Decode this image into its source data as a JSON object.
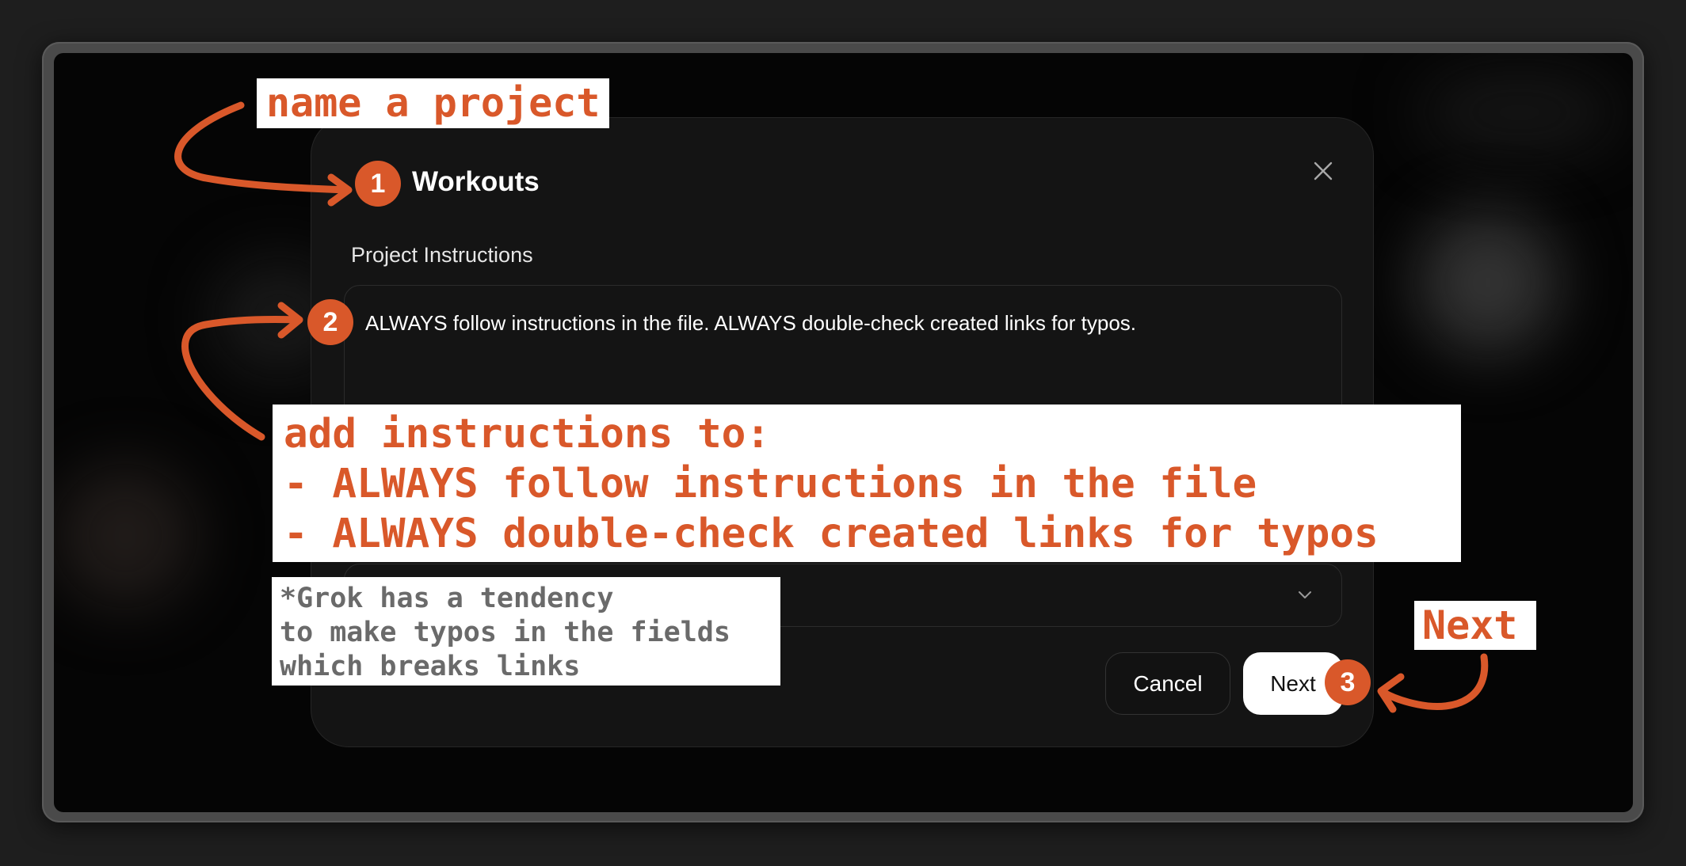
{
  "modal": {
    "project_name": "Workouts",
    "instructions_label": "Project Instructions",
    "instructions_value": "ALWAYS follow instructions in the file. ALWAYS double-check created links for typos.",
    "cancel_label": "Cancel",
    "next_label": "Next"
  },
  "annotations": {
    "name_project": "name a project",
    "add_instructions": "add instructions to:\n- ALWAYS follow instructions in the file\n- ALWAYS double-check created links for typos",
    "grok_note": "*Grok has a tendency\nto make typos in the fields\nwhich breaks links",
    "next": "Next",
    "step1": "1",
    "step2": "2",
    "step3": "3"
  },
  "icons": {
    "close": "close-icon",
    "dropdown": "chevron-down-icon"
  },
  "colors": {
    "accent": "#d9582a",
    "modal_bg": "#141414",
    "screen_bg": "#050505",
    "frame": "#4a4a4a"
  }
}
